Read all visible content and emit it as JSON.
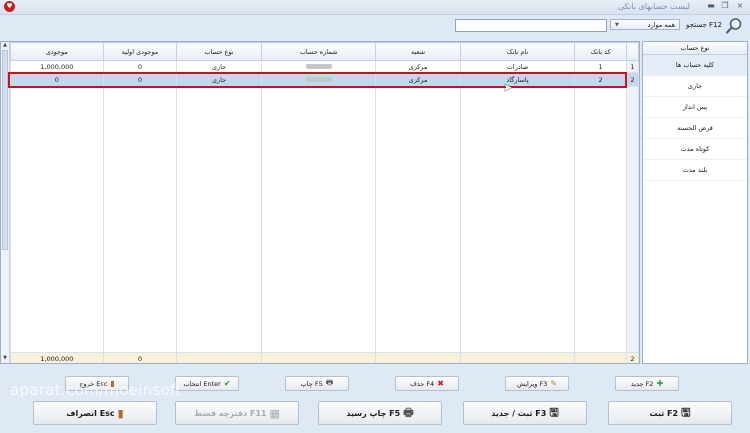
{
  "window": {
    "title": "لیست حسابهای بانکی",
    "close": "×",
    "restore": "❐",
    "minimize": "▬"
  },
  "search": {
    "label": "جستجو F12",
    "scope": "همه موارد",
    "value": ""
  },
  "grid": {
    "columns": [
      "کد بانک",
      "نام بانک",
      "شعبه",
      "شماره حساب",
      "نوع حساب",
      "موجودی اولیه",
      "موجودی"
    ],
    "rows": [
      {
        "rownum": "1",
        "code": "1",
        "bank": "صادرات",
        "branch": "مرکزی",
        "type": "جاری",
        "initial": "0",
        "balance": "1,000,000"
      },
      {
        "rownum": "2",
        "code": "2",
        "bank": "پاسارگاد",
        "branch": "مرکزی",
        "type": "جاری",
        "initial": "0",
        "balance": "0"
      }
    ],
    "footer": {
      "rownum": "2",
      "initial": "0",
      "balance": "1,000,000"
    }
  },
  "account_types": {
    "header": "نوع حساب",
    "items": [
      "کلیه حساب ها",
      "جاری",
      "پس انداز",
      "قرض الحسنه",
      "کوتاه مدت",
      "بلند مدت"
    ],
    "selected": "کلیه حساب ها"
  },
  "toolbar": {
    "new": "جدید F2",
    "edit": "ویرایش F3",
    "delete": "حذف F4",
    "print": "چاپ F5",
    "select": "انتخاب Enter",
    "exit": "خروج Esc"
  },
  "actions": {
    "save": "ثبت F2",
    "save_new": "ثبت / جدید F3",
    "print_receipt": "چاپ رسید F5",
    "installment_book": "دفترچه قسط F11",
    "cancel": "انصراف Esc"
  },
  "watermark": "aparat.com/moeinsoft",
  "colors": {
    "selection_border": "#c8101f",
    "selection_row": "#c5d7ed",
    "footer_row": "#f7f2d9"
  }
}
